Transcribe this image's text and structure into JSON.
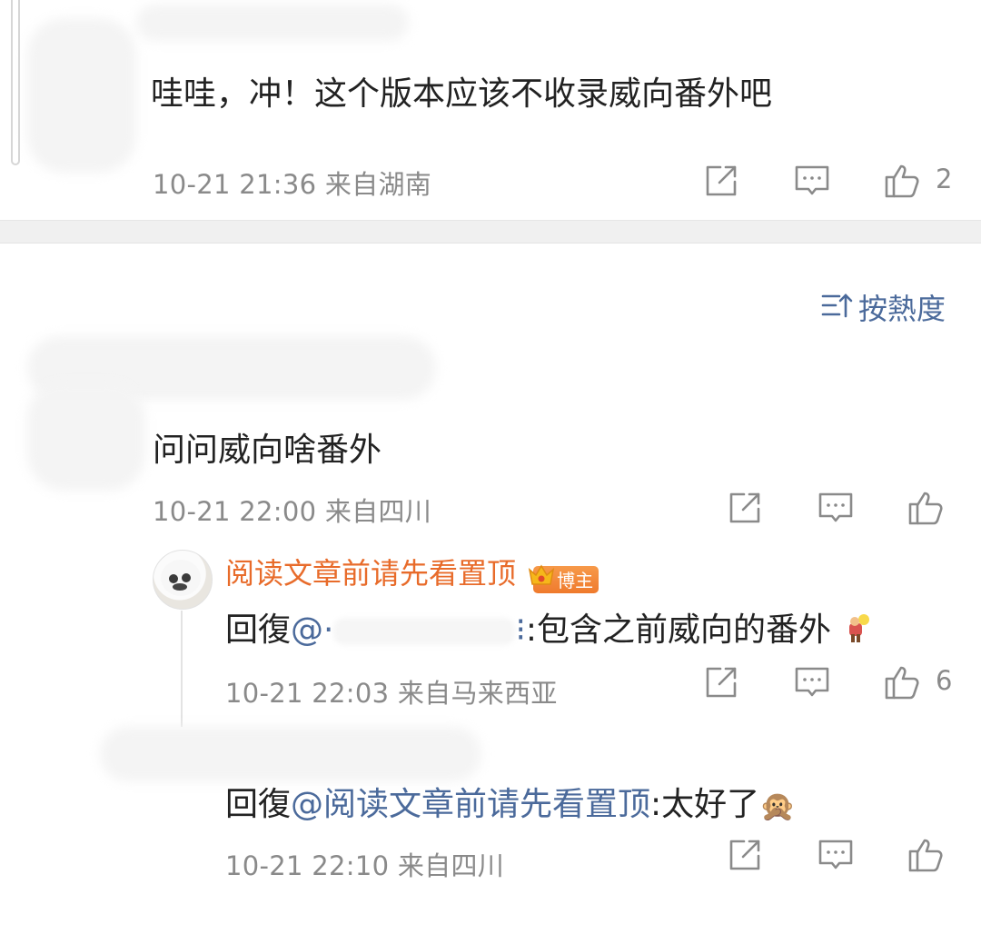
{
  "colors": {
    "meta_text": "#8a8a8a",
    "link": "#4b6a9b",
    "author": "#e86b2a",
    "badge": "#ef7a2d",
    "divider": "#f0f0f0"
  },
  "icons": {
    "share": "share-icon",
    "comment": "comment-icon",
    "like": "thumbs-up-icon",
    "sort": "sort-icon",
    "crown": "crown-icon"
  },
  "comment1": {
    "text": "哇哇，冲！这个版本应该不收录威向番外吧",
    "meta": "10-21 21:36  来自湖南",
    "likes": "2"
  },
  "sort": {
    "label": "按熱度"
  },
  "comment2": {
    "text": "问问威向啥番外",
    "meta": "10-21 22:00  来自四川",
    "likes": ""
  },
  "reply1": {
    "author": "阅读文章前请先看置顶",
    "badge": "博主",
    "prefix": "回復",
    "mention": "@·",
    "mention_end": "⁝",
    "body": ":包含之前威向的番外",
    "meta": "10-21 22:03  来自马来西亚",
    "likes": "6"
  },
  "reply2": {
    "prefix": "回復",
    "mention": "@阅读文章前请先看置顶",
    "body": ":太好了",
    "emoji": "🙊",
    "meta": "10-21 22:10  来自四川",
    "likes": ""
  }
}
